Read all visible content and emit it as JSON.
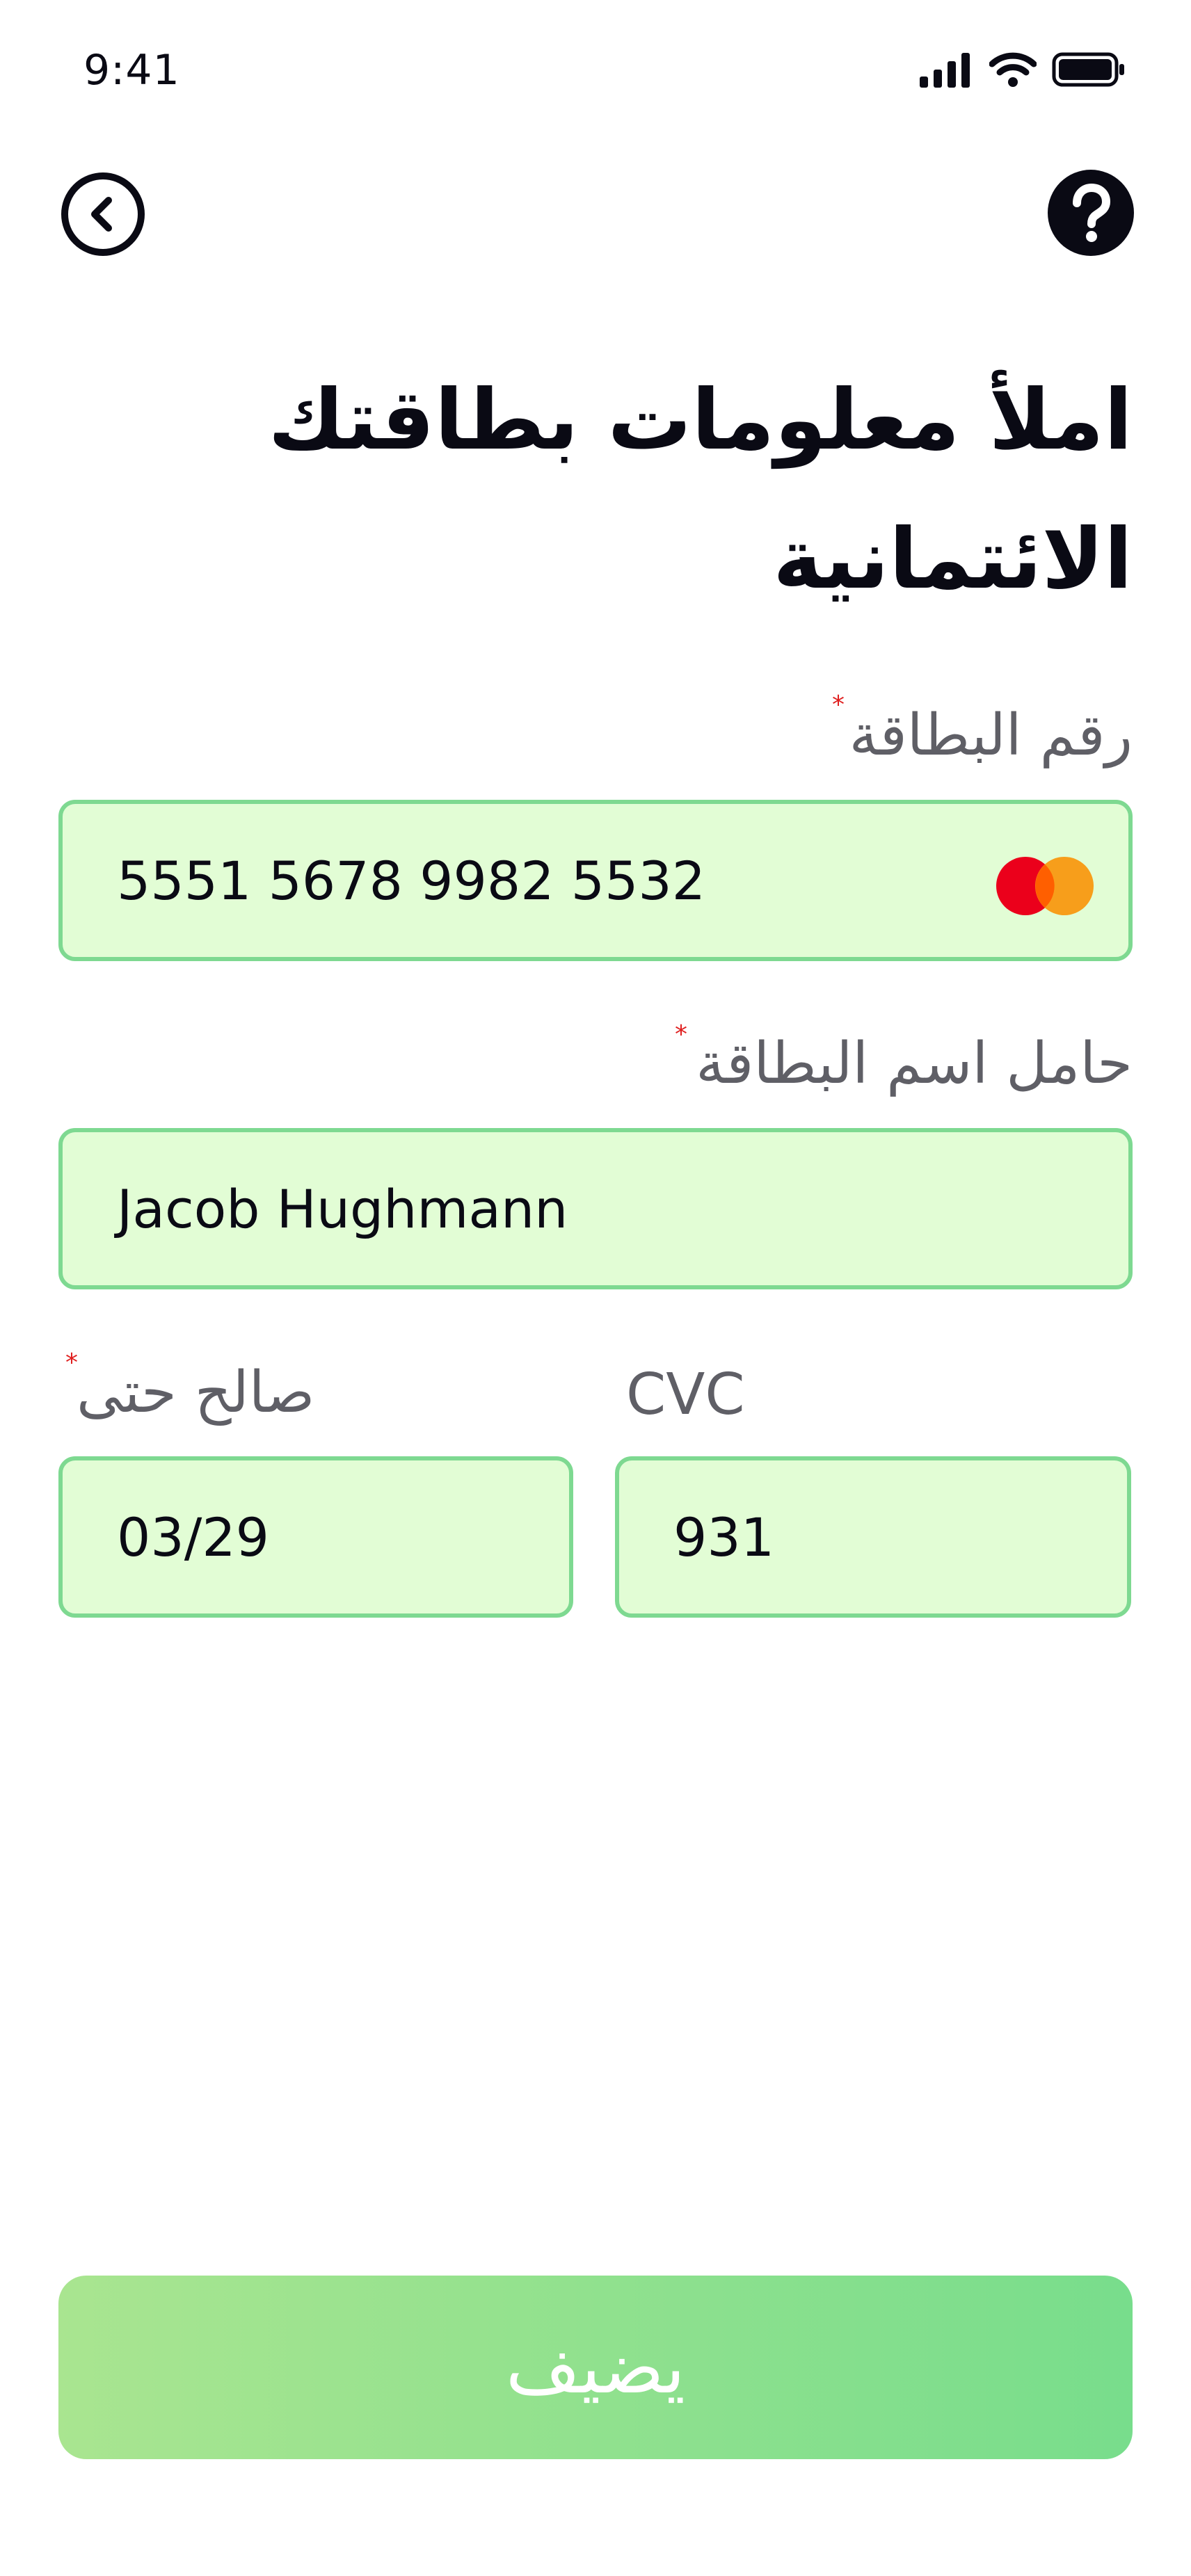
{
  "status_bar": {
    "time": "9:41",
    "icons": [
      "cellular-signal-icon",
      "wifi-icon",
      "battery-icon"
    ]
  },
  "header": {
    "back_icon": "chevron-left-circle-icon",
    "help_icon": "question-circle-icon"
  },
  "title": "املأ معلومات بطاقتك الائتمانية",
  "form": {
    "card_number": {
      "label": "رقم البطاقة",
      "required": true,
      "value": "5551 5678 9982 5532",
      "brand_icon": "mastercard-icon"
    },
    "card_holder": {
      "label": "حامل اسم البطاقة",
      "required": true,
      "value": "Jacob Hughmann"
    },
    "valid_until": {
      "label": "صالح حتى",
      "required": true,
      "value": "03/29"
    },
    "cvc": {
      "label": "CVC",
      "required": false,
      "value": "931"
    }
  },
  "submit_label": "يضيف",
  "colors": {
    "field_background": "#e2fdd5",
    "field_border": "#7ed991",
    "required_star": "#e02020",
    "button_gradient_start": "#a9e590",
    "button_gradient_end": "#78dd8c",
    "mastercard_red": "#eb001b",
    "mastercard_orange": "#f79e1b"
  }
}
